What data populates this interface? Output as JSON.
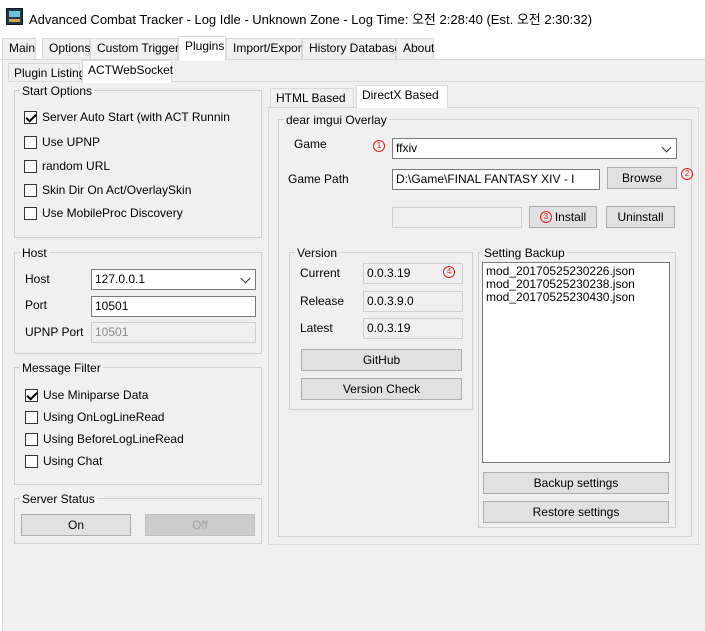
{
  "window": {
    "title": "Advanced Combat Tracker - Log Idle - Unknown Zone - Log Time: 오전 2:28:40 (Est. 오전 2:30:32)"
  },
  "main_tabs": [
    "Main",
    "Options",
    "Custom Triggers",
    "Plugins",
    "Import/Export",
    "History Database",
    "About"
  ],
  "main_active": "Plugins",
  "plugin_tabs": [
    "Plugin Listing",
    "ACTWebSocket"
  ],
  "overlay_tabs": [
    "HTML Based",
    "DirectX Based"
  ],
  "start_options": {
    "title": "Start Options",
    "server_auto_start": {
      "label": "Server Auto Start (with ACT Runnin",
      "checked": true
    },
    "use_upnp": {
      "label": "Use UPNP",
      "checked": false
    },
    "random_url": {
      "label": "random URL",
      "checked": false
    },
    "skin_dir": {
      "label": "Skin Dir On Act/OverlaySkin",
      "checked": false
    },
    "mobileproc": {
      "label": "Use MobileProc Discovery",
      "checked": false
    }
  },
  "host": {
    "title": "Host",
    "host_label": "Host",
    "host_value": "127.0.0.1",
    "port_label": "Port",
    "port_value": "10501",
    "upnp_label": "UPNP Port",
    "upnp_value": "10501"
  },
  "message_filter": {
    "title": "Message Filter",
    "miniparse": {
      "label": "Use Miniparse Data",
      "checked": true
    },
    "onlogline": {
      "label": "Using OnLogLineRead",
      "checked": false
    },
    "beforelogline": {
      "label": "Using BeforeLogLineRead",
      "checked": false
    },
    "chat": {
      "label": "Using Chat",
      "checked": false
    }
  },
  "server_status": {
    "title": "Server Status",
    "on_label": "On",
    "off_label": "Off"
  },
  "overlay": {
    "title": "dear imgui Overlay",
    "game_label": "Game",
    "game_value": "ffxiv",
    "path_label": "Game Path",
    "path_value": "D:\\Game\\FINAL FANTASY XIV - I",
    "browse_label": "Browse",
    "install_label": "Install",
    "uninstall_label": "Uninstall",
    "markers": {
      "m1": "1",
      "m2": "2",
      "m3": "3",
      "m4": "4"
    }
  },
  "version": {
    "title": "Version",
    "current_label": "Current",
    "current_value": "0.0.3.19",
    "release_label": "Release",
    "release_value": "0.0.3.9.0",
    "latest_label": "Latest",
    "latest_value": "0.0.3.19",
    "github_label": "GitHub",
    "check_label": "Version Check"
  },
  "backup": {
    "title": "Setting Backup",
    "files": [
      "mod_20170525230226.json",
      "mod_20170525230238.json",
      "mod_20170525230430.json"
    ],
    "backup_label": "Backup settings",
    "restore_label": "Restore settings"
  },
  "colors": {
    "marker": "#e02020",
    "panel": "#f0f0f0",
    "border": "#d0d0d0"
  },
  "icons": {
    "app": "act-app-icon",
    "checkbox": "checkbox",
    "dropdown": "chevron-down-icon"
  }
}
